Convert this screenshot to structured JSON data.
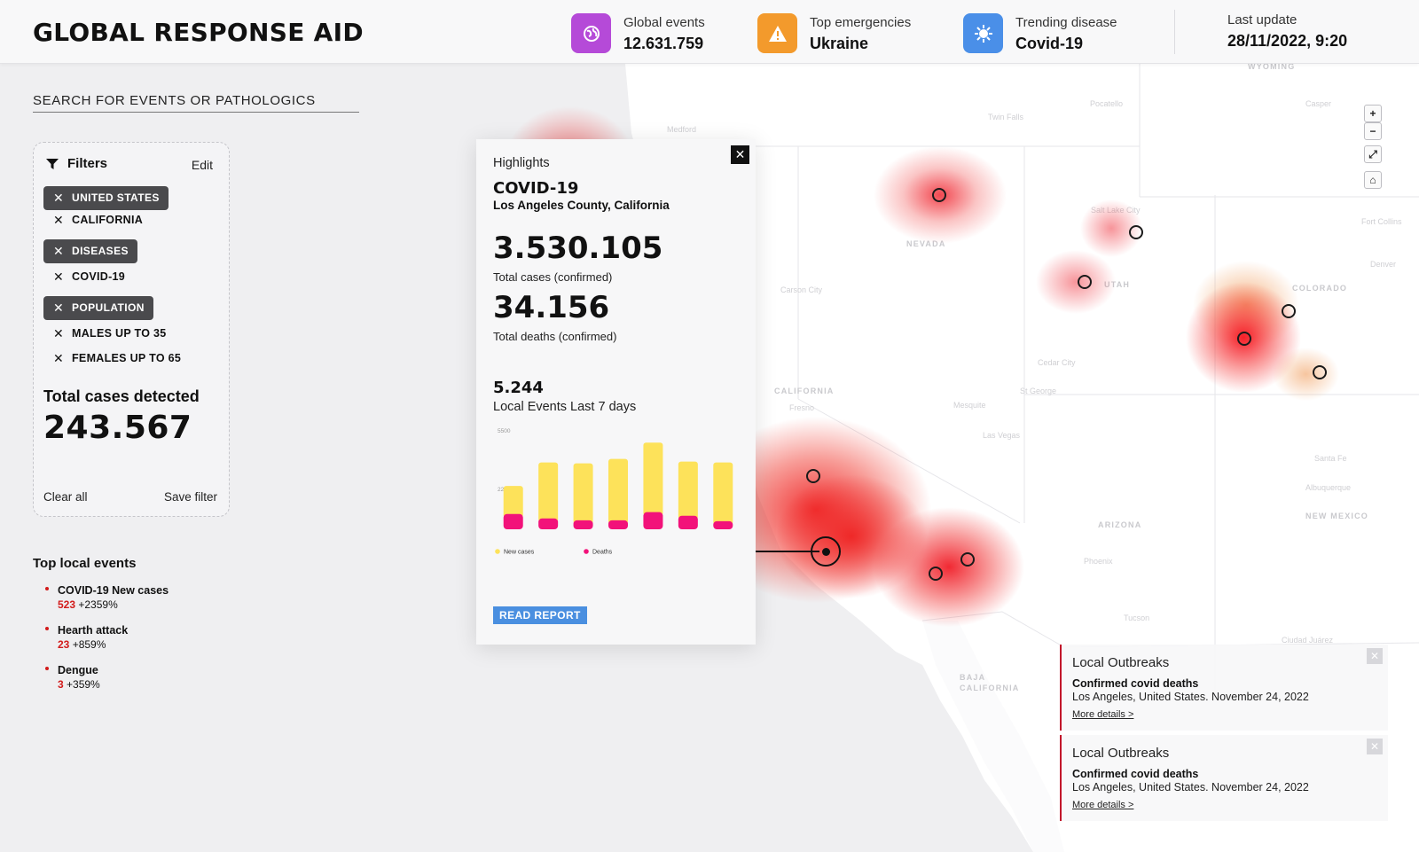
{
  "header": {
    "brand": "GLOBAL RESPONSE AID",
    "stats": [
      {
        "icon": "globe-icon",
        "color": "#b54ad8",
        "label": "Global events",
        "value": "12.631.759"
      },
      {
        "icon": "warning-icon",
        "color": "#f39a2c",
        "label": "Top emergencies",
        "value": "Ukraine"
      },
      {
        "icon": "virus-icon",
        "color": "#4a8fe8",
        "label": "Trending disease",
        "value": "Covid-19"
      }
    ],
    "last_update": {
      "label": "Last update",
      "value": "28/11/2022, 9:20"
    }
  },
  "search": {
    "placeholder": "SEARCH FOR EVENTS OR PATHOLOGICS"
  },
  "filters": {
    "title": "Filters",
    "edit": "Edit",
    "groups": [
      {
        "chip": "UNITED STATES",
        "items": [
          "CALIFORNIA"
        ]
      },
      {
        "chip": "DISEASES",
        "items": [
          "COVID-19"
        ]
      },
      {
        "chip": "POPULATION",
        "items": [
          "MALES UP TO 35",
          "FEMALES UP TO 65"
        ]
      }
    ],
    "total_label": "Total cases detected",
    "total_value": "243.567",
    "clear_all": "Clear all",
    "save_filter": "Save filter"
  },
  "top_events": {
    "title": "Top local events",
    "items": [
      {
        "name": "COVID-19 New cases",
        "count": "523",
        "change": "+2359%"
      },
      {
        "name": "Hearth attack",
        "count": "23",
        "change": "+859%"
      },
      {
        "name": "Dengue",
        "count": "3",
        "change": "+359%"
      }
    ]
  },
  "highlights": {
    "label": "Highlights",
    "disease": "COVID-19",
    "location": "Los Angeles County, California",
    "total_cases": "3.530.105",
    "total_cases_label": "Total cases (confirmed)",
    "total_deaths": "34.156",
    "total_deaths_label": "Total deaths (confirmed)",
    "local_events": "5.244",
    "local_events_label": "Local Events Last 7 days",
    "read_report": "READ REPORT",
    "close_symbol": "✕"
  },
  "chart_data": {
    "type": "bar",
    "stacked": true,
    "categories": [
      "",
      "",
      "",
      "",
      "",
      "",
      ""
    ],
    "ylim": [
      0,
      5500
    ],
    "yticks": [
      5500,
      2250
    ],
    "series": [
      {
        "name": "New cases",
        "color": "#fde25a",
        "values": [
          1550,
          3100,
          3150,
          3400,
          3850,
          3000,
          3250
        ]
      },
      {
        "name": "Deaths",
        "color": "#f2127a",
        "values": [
          850,
          600,
          500,
          500,
          950,
          750,
          450
        ]
      }
    ],
    "legend_position": "bottom-left",
    "grid": false
  },
  "map": {
    "state_labels": [
      "NEVADA",
      "UTAH",
      "COLORADO",
      "CALIFORNIA",
      "ARIZONA",
      "NEW MEXICO",
      "WYOMING",
      "BAJA CALIFORNIA"
    ],
    "city_labels": [
      "Twin Falls",
      "Pocatello",
      "Casper",
      "Medford",
      "Salt Lake City",
      "Fort Collins",
      "Carson City",
      "Denver",
      "Cedar City",
      "Fresno",
      "St George",
      "Mesquite",
      "Las Vegas",
      "Santa Fe",
      "Albuquerque",
      "Phoenix",
      "Tucson",
      "Ciudad Juárez"
    ],
    "controls": [
      "+",
      "−",
      "⤢",
      "⌂"
    ]
  },
  "outbreaks": [
    {
      "title": "Local Outbreaks",
      "heading": "Confirmed covid deaths",
      "desc": "Los Angeles, United States. November 24, 2022",
      "link": "More details >",
      "close_symbol": "✕"
    },
    {
      "title": "Local Outbreaks",
      "heading": "Confirmed covid deaths",
      "desc": "Los Angeles, United States. November 24, 2022",
      "link": "More details >",
      "close_symbol": "✕"
    }
  ]
}
